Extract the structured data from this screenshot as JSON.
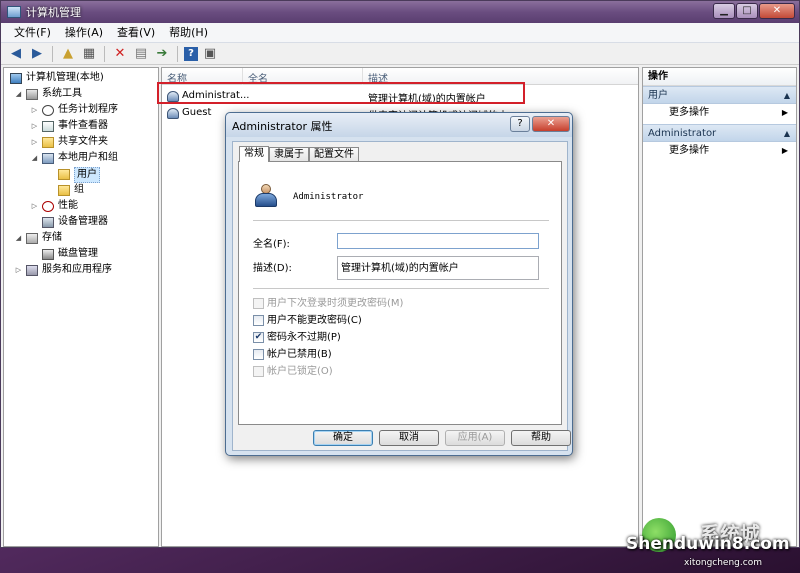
{
  "window": {
    "title": "计算机管理",
    "controls": {
      "minimize": "▁",
      "maximize": "□",
      "close": "✕"
    }
  },
  "menu": [
    "文件(F)",
    "操作(A)",
    "查看(V)",
    "帮助(H)"
  ],
  "toolbar": {
    "icons": [
      "back-icon",
      "forward-icon",
      "up-folder-icon",
      "show-tree-icon",
      "delete-icon",
      "properties-icon",
      "export-icon",
      "help-icon",
      "view-icon"
    ]
  },
  "tree": {
    "root": "计算机管理(本地)",
    "system_tools": "系统工具",
    "task_scheduler": "任务计划程序",
    "event_viewer": "事件查看器",
    "shared_folders": "共享文件夹",
    "local_users_groups": "本地用户和组",
    "users": "用户",
    "groups": "组",
    "performance": "性能",
    "device_manager": "设备管理器",
    "storage": "存储",
    "disk_management": "磁盘管理",
    "services_apps": "服务和应用程序"
  },
  "list": {
    "columns": [
      "名称",
      "全名",
      "描述"
    ],
    "rows": [
      {
        "name": "Administrat...",
        "fullname": "",
        "desc": "管理计算机(域)的内置帐户"
      },
      {
        "name": "Guest",
        "fullname": "",
        "desc": "供来宾访问计算机或访问域的内..."
      }
    ]
  },
  "actions": {
    "header": "操作",
    "section1": "用户",
    "section1_item": "更多操作",
    "section2": "Administrator",
    "section2_item": "更多操作"
  },
  "dialog": {
    "title": "Administrator 属性",
    "help_btn": "?",
    "close_btn": "✕",
    "tabs": [
      "常规",
      "隶属于",
      "配置文件"
    ],
    "username": "Administrator",
    "fullname_label": "全名(F):",
    "fullname_value": "",
    "desc_label": "描述(D):",
    "desc_value": "管理计算机(域)的内置帐户",
    "checks": [
      {
        "label": "用户下次登录时须更改密码(M)",
        "checked": false,
        "disabled": true
      },
      {
        "label": "用户不能更改密码(C)",
        "checked": false,
        "disabled": false
      },
      {
        "label": "密码永不过期(P)",
        "checked": true,
        "disabled": false
      },
      {
        "label": "帐户已禁用(B)",
        "checked": false,
        "disabled": false
      },
      {
        "label": "帐户已锁定(O)",
        "checked": false,
        "disabled": true
      }
    ],
    "buttons": {
      "ok": "确定",
      "cancel": "取消",
      "apply": "应用(A)",
      "help": "帮助"
    }
  },
  "watermark": {
    "brand": "Shenduwin8.com",
    "site": "xitongcheng.com",
    "cn": "系统城"
  }
}
